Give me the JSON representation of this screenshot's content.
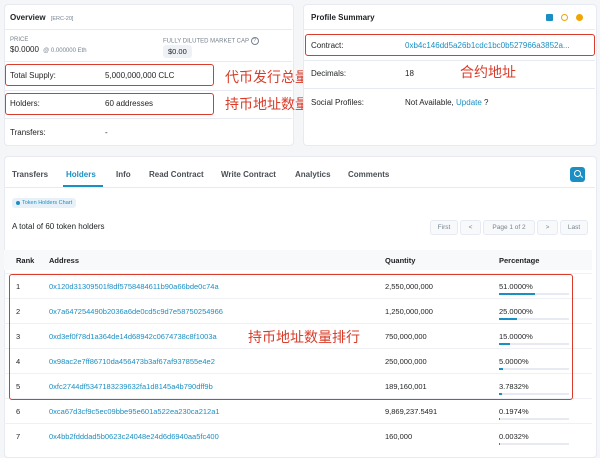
{
  "overview": {
    "title": "Overview",
    "standard": "[ERC-20]",
    "price_label": "PRICE",
    "price_value": "$0.0000",
    "price_eth": "@ 0.000000 Eth",
    "market_cap_label": "FULLY DILUTED MARKET CAP",
    "market_cap_value": "$0.00",
    "rows": [
      {
        "label": "Total Supply:",
        "value": "5,000,000,000 CLC"
      },
      {
        "label": "Holders:",
        "value": "60 addresses"
      },
      {
        "label": "Transfers:",
        "value": "-"
      }
    ]
  },
  "profile": {
    "title": "Profile Summary",
    "rows": [
      {
        "label": "Contract:",
        "value": "0xb4c146dd5a26b1cdc1bc0b527966a3852a..."
      },
      {
        "label": "Decimals:",
        "value": "18"
      },
      {
        "label": "Social Profiles:",
        "value": "Not Available,",
        "link": "Update",
        "suffix": "?"
      }
    ]
  },
  "annotations": {
    "total_supply": "代币发行总量",
    "holders": "持币地址数量",
    "contract": "合约地址",
    "ranking": "持币地址数量排行"
  },
  "tabs": [
    "Transfers",
    "Holders",
    "Info",
    "Read Contract",
    "Write Contract",
    "Analytics",
    "Comments"
  ],
  "chart_button": "Token Holders Chart",
  "total_text": "A total of 60 token holders",
  "pagination": {
    "first": "First",
    "prev": "<",
    "page": "Page 1 of 2",
    "next": ">",
    "last": "Last"
  },
  "table": {
    "headers": [
      "Rank",
      "Address",
      "Quantity",
      "Percentage"
    ],
    "rows": [
      {
        "rank": "1",
        "address": "0x120d31309501f8df5758484611b90a66bde0c74a",
        "quantity": "2,550,000,000",
        "percentage": "51.0000%",
        "pct": 51.0
      },
      {
        "rank": "2",
        "address": "0x7a647254490b2036a6de0cd5c9d7e58750254966",
        "quantity": "1,250,000,000",
        "percentage": "25.0000%",
        "pct": 25.0
      },
      {
        "rank": "3",
        "address": "0xd3ef0f78d1a364de14d68942c0674738c8f1003a",
        "quantity": "750,000,000",
        "percentage": "15.0000%",
        "pct": 15.0
      },
      {
        "rank": "4",
        "address": "0x98ac2e7ff86710da456473b3af67af937855e4e2",
        "quantity": "250,000,000",
        "percentage": "5.0000%",
        "pct": 5.0
      },
      {
        "rank": "5",
        "address": "0xfc2744df5347183239632fa1d8145a4b790dff9b",
        "quantity": "189,160,001",
        "percentage": "3.7832%",
        "pct": 3.7832
      },
      {
        "rank": "6",
        "address": "0xca67d3cf9c5ec09bbe95e601a522ea230ca212a1",
        "quantity": "9,869,237.5491",
        "percentage": "0.1974%",
        "pct": 0.1974
      },
      {
        "rank": "7",
        "address": "0x4bb2fdddad5b0623c24048e24d6d6940aa5fc400",
        "quantity": "160,000",
        "percentage": "0.0032%",
        "pct": 0.0032
      }
    ]
  },
  "colors": {
    "accent": "#1a8fc4",
    "annotation_red": "#d93c2a",
    "progress": "#1a8fc4"
  }
}
